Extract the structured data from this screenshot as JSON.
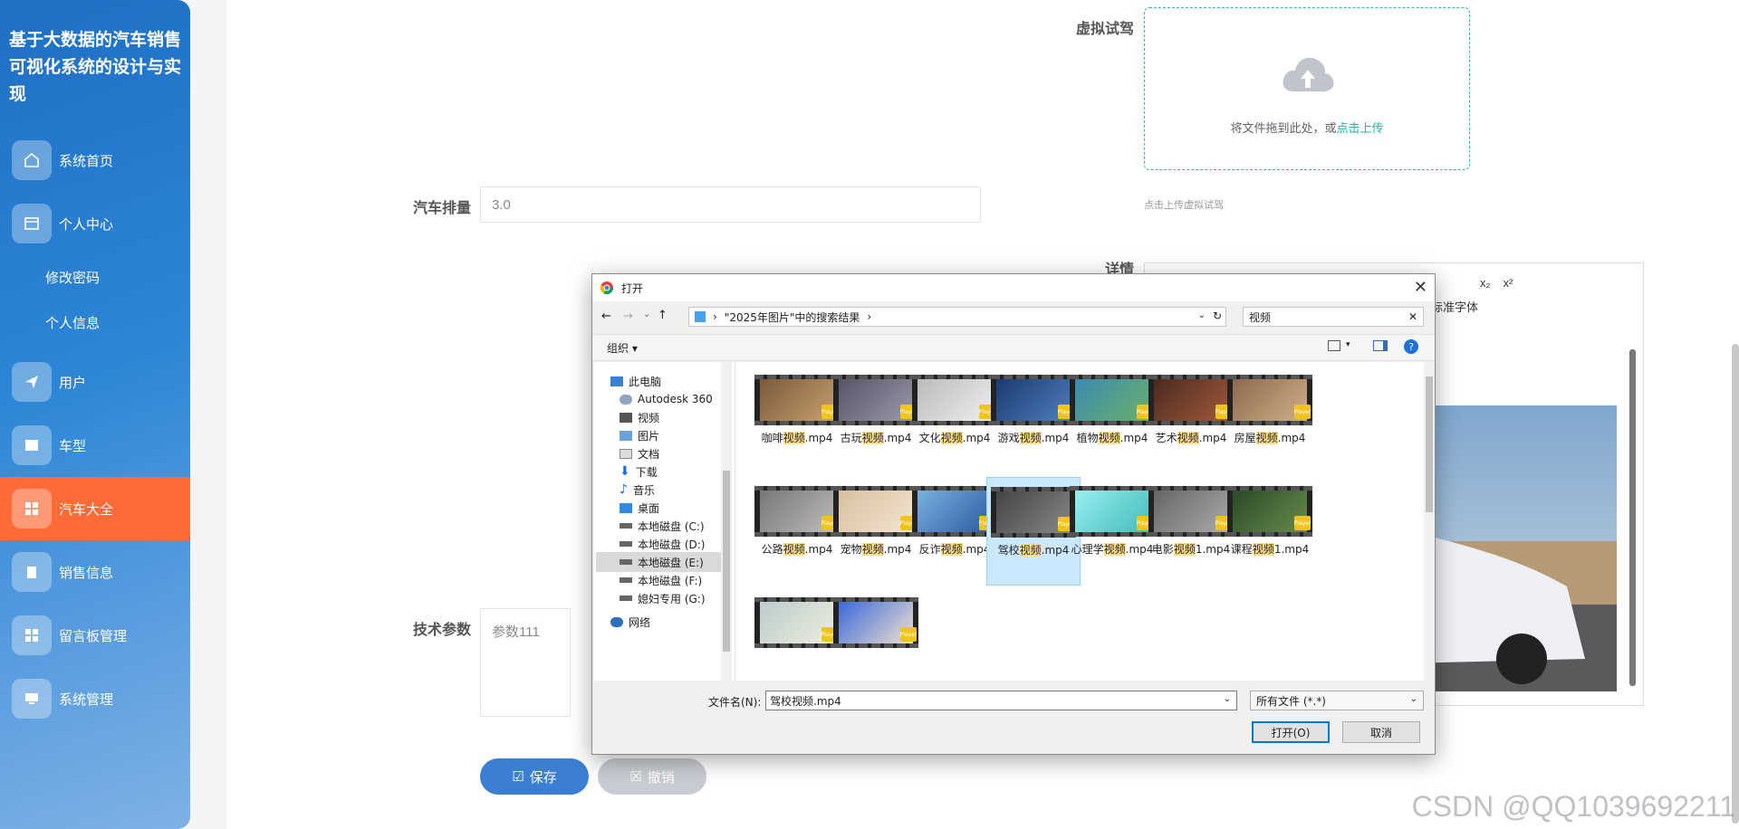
{
  "sidebar": {
    "title": "基于大数据的汽车销售可视化系统的设计与实现",
    "items": [
      {
        "label": "系统首页",
        "icon": "home-icon"
      },
      {
        "label": "个人中心",
        "icon": "id-card-icon"
      },
      {
        "label": "用户",
        "icon": "send-icon"
      },
      {
        "label": "车型",
        "icon": "image-icon"
      },
      {
        "label": "汽车大全",
        "icon": "grid-icon"
      },
      {
        "label": "销售信息",
        "icon": "clipboard-icon"
      },
      {
        "label": "留言板管理",
        "icon": "grid-icon"
      },
      {
        "label": "系统管理",
        "icon": "monitor-icon"
      }
    ],
    "sub": [
      "修改密码",
      "个人信息"
    ],
    "active_color": "#ff6a39"
  },
  "form": {
    "virtual_drive_label": "虚拟试驾",
    "upload_text": "将文件拖到此处，或",
    "upload_link": "点击上传",
    "upload_hint": "点击上传虚拟试驾",
    "displacement_label": "汽车排量",
    "displacement_value": "3.0",
    "detail_label": "详情",
    "tech_label": "技术参数",
    "tech_value": "参数111",
    "save": "保存",
    "cancel": "撤销"
  },
  "editor": {
    "sub": "x₂",
    "sup": "x²",
    "font": "标准字体"
  },
  "dialog": {
    "title": "打开",
    "path": "\"2025年图片\"中的搜索结果",
    "search": "视频",
    "organize": "组织",
    "nav": [
      "此电脑",
      "Autodesk 360",
      "视频",
      "图片",
      "文档",
      "下载",
      "音乐",
      "桌面",
      "本地磁盘 (C:)",
      "本地磁盘 (D:)",
      "本地磁盘 (E:)",
      "本地磁盘 (F:)",
      "媳妇专用 (G:)",
      "网络"
    ],
    "files": [
      {
        "pre": "咖啡",
        "hl": "视频",
        "post": ".mp4"
      },
      {
        "pre": "古玩",
        "hl": "视频",
        "post": ".mp4"
      },
      {
        "pre": "文化",
        "hl": "视频",
        "post": ".mp4"
      },
      {
        "pre": "游戏",
        "hl": "视频",
        "post": ".mp4"
      },
      {
        "pre": "植物",
        "hl": "视频",
        "post": ".mp4"
      },
      {
        "pre": "艺术",
        "hl": "视频",
        "post": ".mp4"
      },
      {
        "pre": "房屋",
        "hl": "视频",
        "post": ".mp4"
      },
      {
        "pre": "公路",
        "hl": "视频",
        "post": ".mp4"
      },
      {
        "pre": "宠物",
        "hl": "视频",
        "post": ".mp4"
      },
      {
        "pre": "反诈",
        "hl": "视频",
        "post": ".mp4"
      },
      {
        "pre": "驾校",
        "hl": "视频",
        "post": ".mp4"
      },
      {
        "pre": "心理学",
        "hl": "视频",
        "post": ".mp4"
      },
      {
        "pre": "电影",
        "hl": "视频",
        "post": "1.mp4"
      },
      {
        "pre": "课程",
        "hl": "视频",
        "post": "1.mp4"
      },
      {
        "pre": "",
        "hl": "",
        "post": ""
      },
      {
        "pre": "",
        "hl": "",
        "post": ""
      }
    ],
    "filename_label": "文件名(N):",
    "filename_value": "驾校视频.mp4",
    "filetype": "所有文件 (*.*)",
    "open": "打开(O)",
    "cancel": "取消",
    "badge": "Player"
  },
  "watermark": "CSDN @QQ1039692211"
}
